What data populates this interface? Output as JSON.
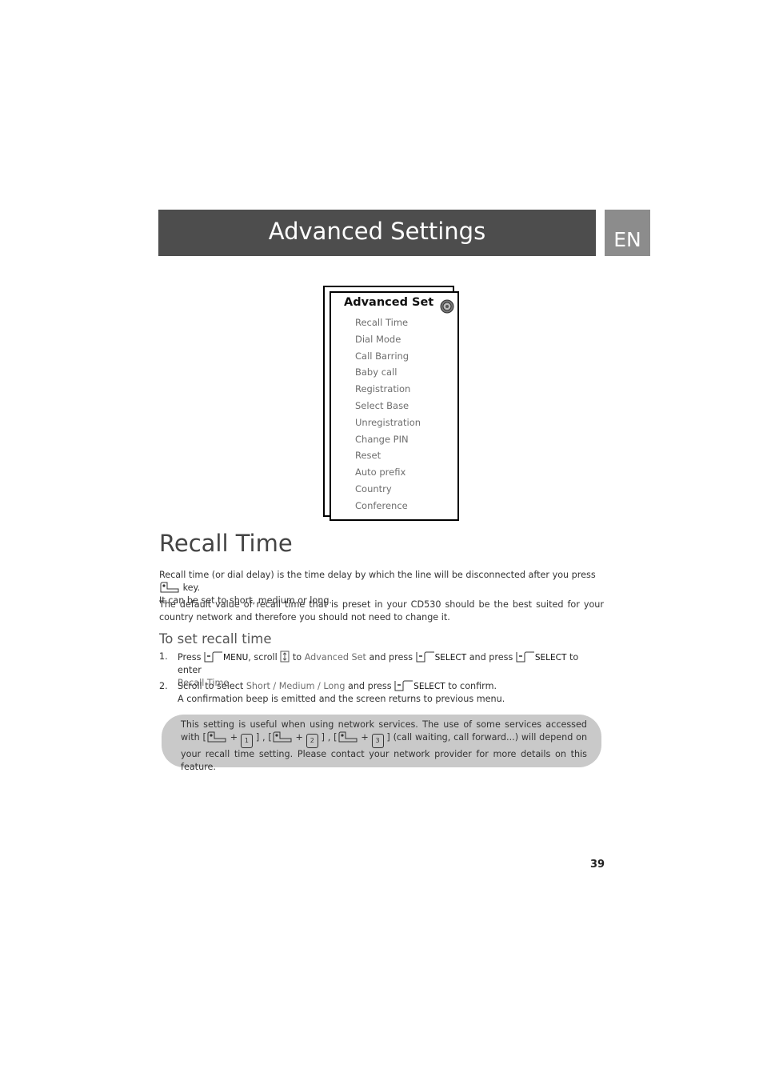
{
  "header": {
    "title": "Advanced Settings",
    "lang": "EN"
  },
  "menu": {
    "title": "Advanced Set",
    "icon": "gear-icon",
    "items": [
      "Recall Time",
      "Dial Mode",
      "Call Barring",
      "Baby call",
      "Registration",
      "Select Base",
      "Unregistration",
      "Change PIN",
      "Reset",
      "Auto prefix",
      "Country",
      "Conference"
    ]
  },
  "section": {
    "title": "Recall Time",
    "p1a": "Recall time (or dial delay) is the time delay by which the line will be disconnected after you press",
    "p1b": "key.",
    "p1c": "It can be set to short, medium or long.",
    "p2": "The default value of recall time that is preset in your CD530 should be the best suited for your country network and therefore you should not need to change it."
  },
  "steps": {
    "title": "To set recall time",
    "s1": {
      "num": "1.",
      "press": "Press",
      "menu": "MENU",
      "scroll": ", scroll",
      "to": "to",
      "adv": "Advanced Set",
      "andpress": "and press",
      "select": "SELECT",
      "andpress2": "and press",
      "select2": "SELECT",
      "toenter": "to enter",
      "recall": "Recall Time",
      "dot": "."
    },
    "s2": {
      "num": "2.",
      "a": "Scroll to select",
      "opts": "Short / Medium / Long",
      "b": "and press",
      "select": "SELECT",
      "c": "to confirm.",
      "d": "A confirmation beep is emitted and the screen returns to previous menu."
    }
  },
  "note": {
    "a": "This setting is useful when using network services. The use of some services accessed with [",
    "plus": "+",
    "sep": "] , [",
    "end": "] (call waiting, call forward...) will depend on your recall time setting. Please contact your network provider for more details on this feature.",
    "keys": [
      "1",
      "2",
      "3"
    ]
  },
  "page_number": "39"
}
